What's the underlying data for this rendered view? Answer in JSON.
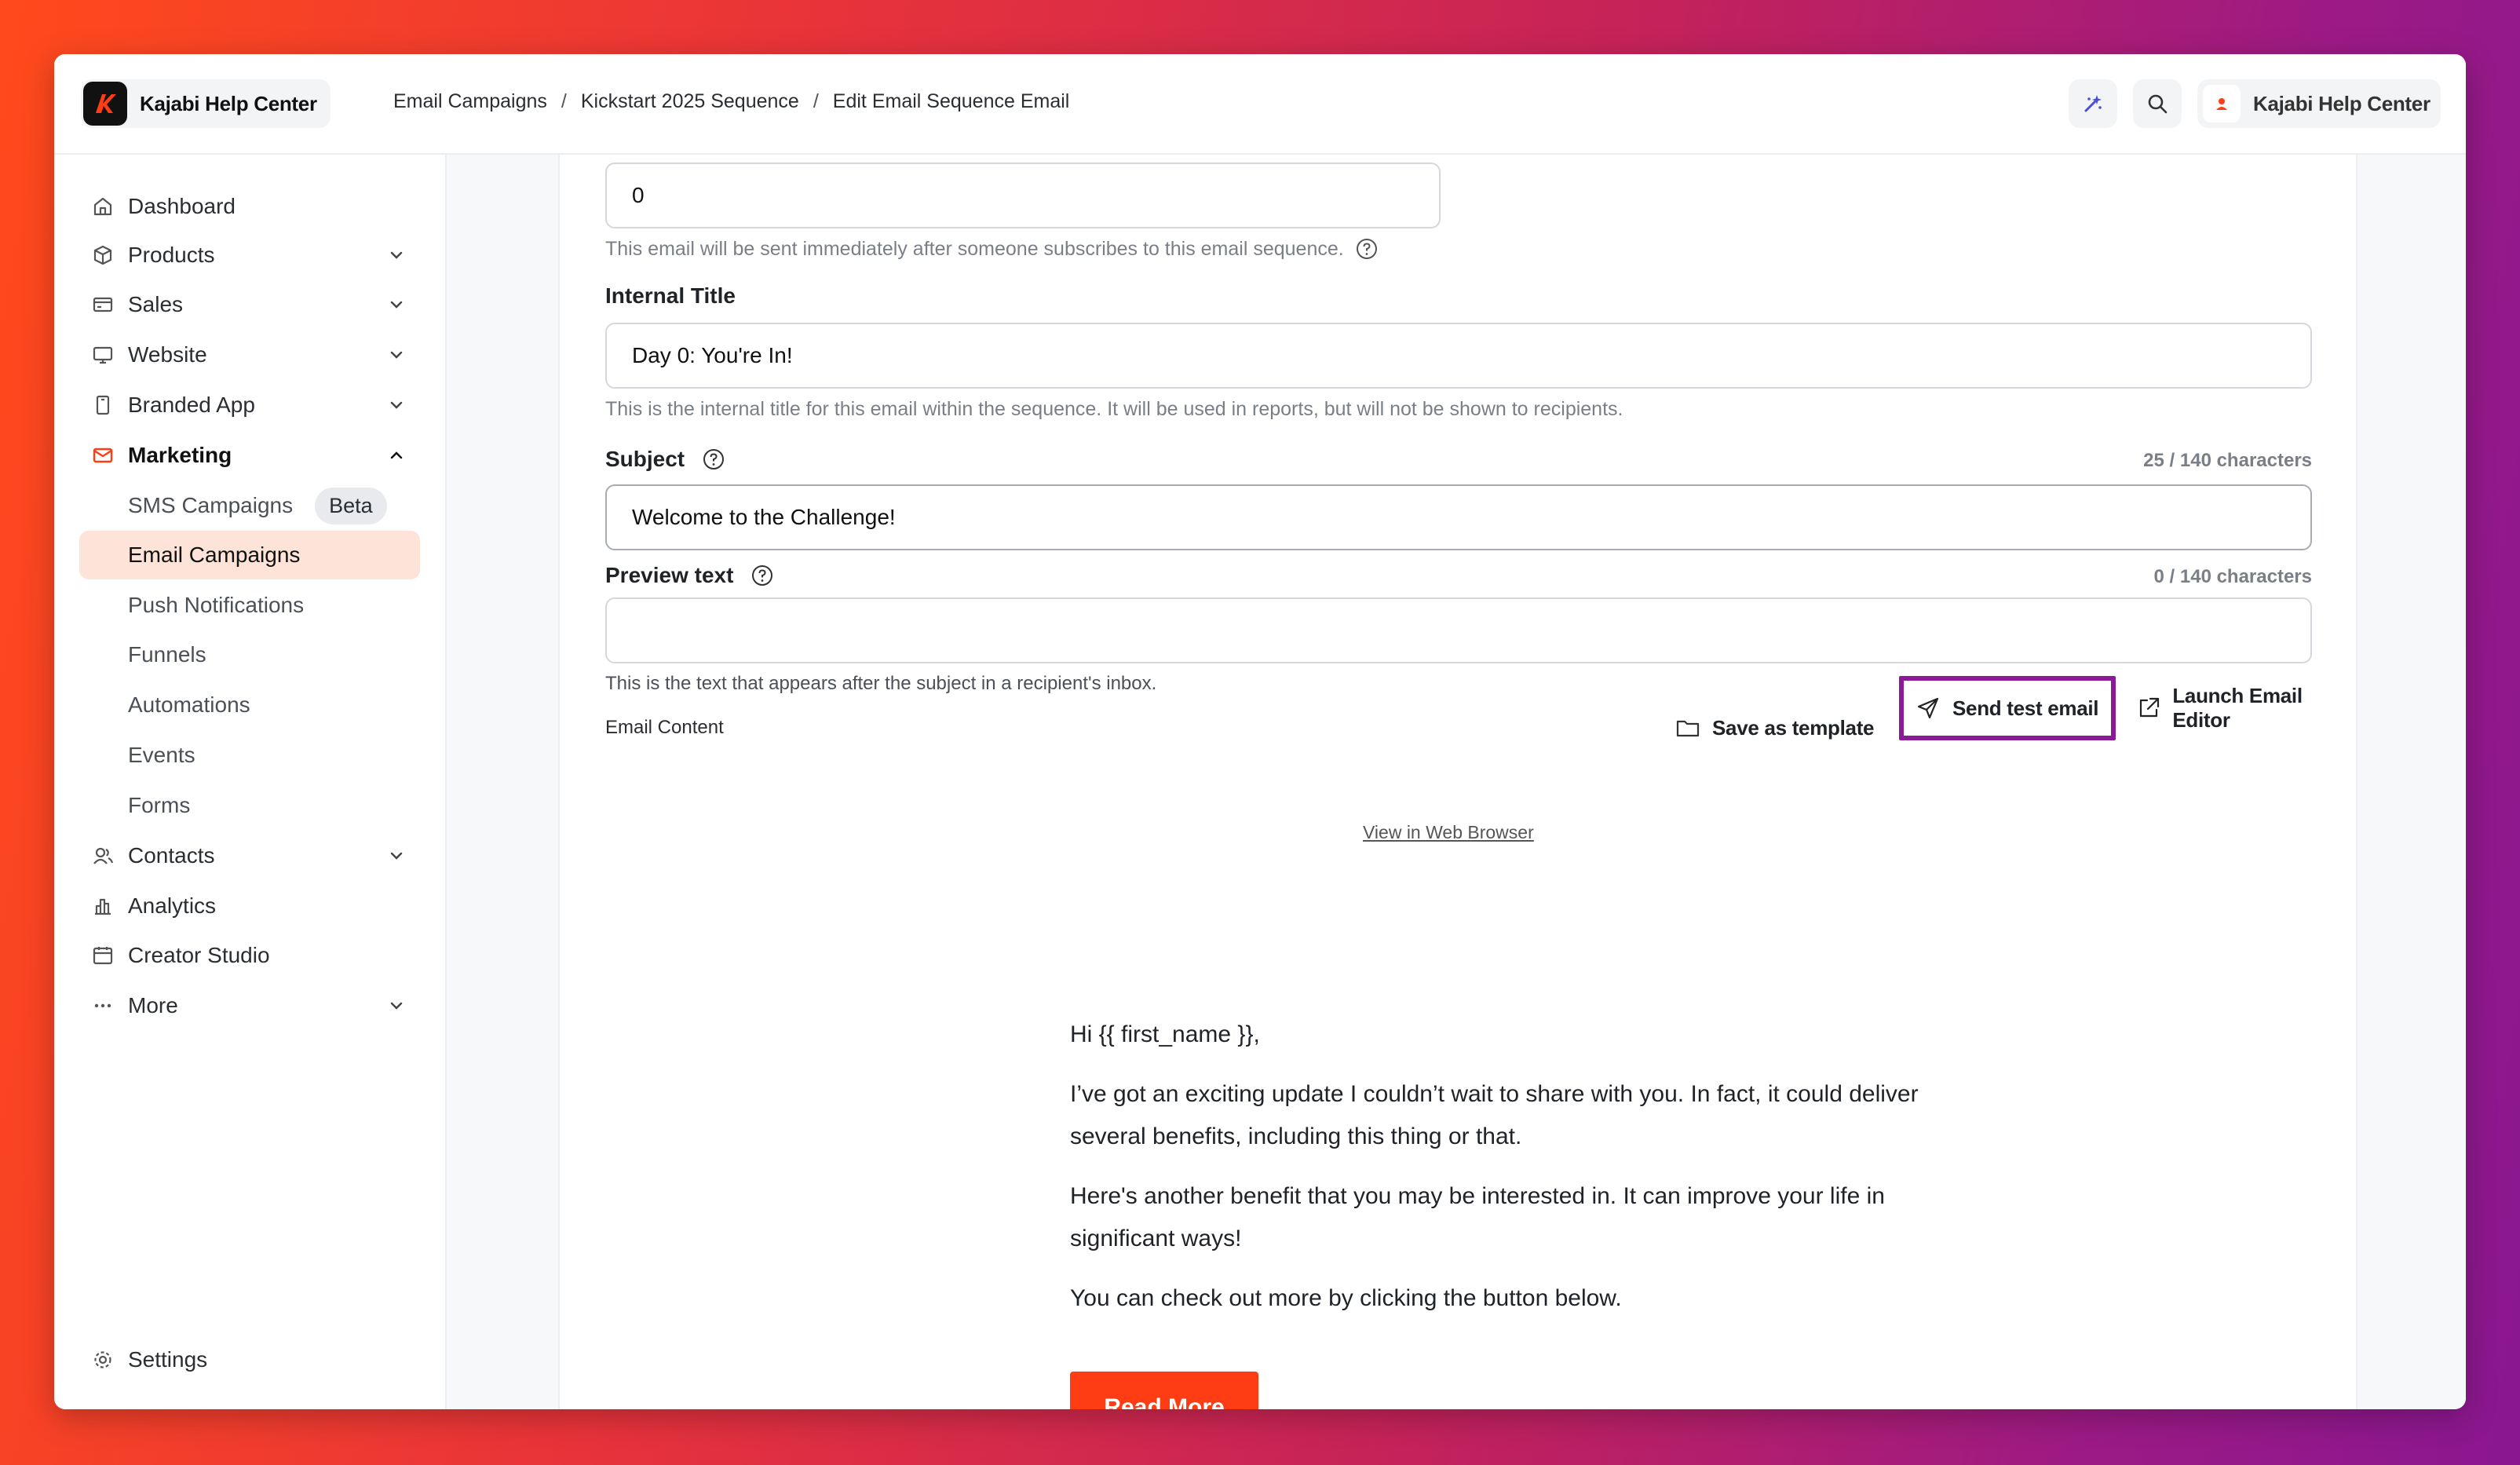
{
  "header": {
    "brand_name": "Kajabi Help Center",
    "breadcrumb": [
      "Email Campaigns",
      "Kickstart 2025 Sequence",
      "Edit Email Sequence Email"
    ],
    "account_name": "Kajabi Help Center"
  },
  "sidebar": {
    "items": [
      {
        "label": "Dashboard",
        "icon": "home-icon",
        "chevron": false
      },
      {
        "label": "Products",
        "icon": "box-icon",
        "chevron": "down"
      },
      {
        "label": "Sales",
        "icon": "credit-card-icon",
        "chevron": "down"
      },
      {
        "label": "Website",
        "icon": "monitor-icon",
        "chevron": "down"
      },
      {
        "label": "Branded App",
        "icon": "phone-icon",
        "chevron": "down"
      },
      {
        "label": "Marketing",
        "icon": "mail-icon",
        "chevron": "up"
      }
    ],
    "marketing_sub": [
      {
        "label": "SMS Campaigns",
        "badge": "Beta"
      },
      {
        "label": "Email Campaigns",
        "active": true
      },
      {
        "label": "Push Notifications"
      },
      {
        "label": "Funnels"
      },
      {
        "label": "Automations"
      },
      {
        "label": "Events"
      },
      {
        "label": "Forms"
      }
    ],
    "items_after": [
      {
        "label": "Contacts",
        "icon": "users-icon",
        "chevron": "down"
      },
      {
        "label": "Analytics",
        "icon": "bar-chart-icon",
        "chevron": false
      },
      {
        "label": "Creator Studio",
        "icon": "calendar-icon",
        "chevron": false
      },
      {
        "label": "More",
        "icon": "ellipsis-icon",
        "chevron": "down"
      }
    ],
    "settings_label": "Settings"
  },
  "form": {
    "delay_value": "0",
    "delay_help": "This email will be sent immediately after someone subscribes to this email sequence.",
    "internal_title_label": "Internal Title",
    "internal_title_value": "Day 0: You're In!",
    "internal_title_help": "This is the internal title for this email within the sequence. It will be used in reports, but will not be shown to recipients.",
    "subject_label": "Subject",
    "subject_counter": "25 / 140 characters",
    "subject_value": "Welcome to the Challenge!",
    "preview_label": "Preview text",
    "preview_counter": "0 / 140 characters",
    "preview_value": "",
    "preview_help": "This is the text that appears after the subject in a recipient's inbox."
  },
  "toolbar": {
    "email_content_label": "Email Content",
    "save_template": "Save as template",
    "send_test": "Send test email",
    "launch_editor": "Launch Email Editor"
  },
  "email": {
    "view_in_browser": "View in Web Browser",
    "greeting": "Hi {{ first_name }},",
    "para1": "I’ve got an exciting update I couldn’t wait to share with you. In fact, it could deliver several benefits, including this thing or that.",
    "para2": "Here's another benefit that you may be interested in. It can improve your life in significant ways!",
    "para3": "You can check out more by clicking the button below.",
    "cta_label": "Read More"
  },
  "colors": {
    "accent": "#ff3d14",
    "active_nav_bg": "#fde3d8",
    "highlight": "#8b1a97"
  }
}
